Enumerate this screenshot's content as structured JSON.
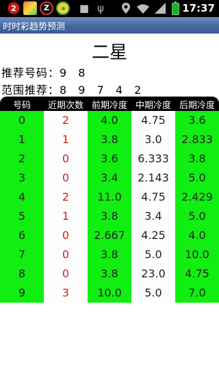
{
  "status_bar": {
    "notification_count": "2",
    "app2_letter": "Z",
    "time": "17:37",
    "icons": [
      "notification-badge-icon",
      "app-icon",
      "z-app-icon",
      "app-icon",
      "android-icon",
      "usb-icon",
      "gps-icon",
      "wifi-icon",
      "signal-icon",
      "battery-icon"
    ]
  },
  "title_bar": {
    "title": "时时彩趋势预测"
  },
  "heading": "二星",
  "recommend": {
    "label": "推荐号码：",
    "value": "9 8"
  },
  "range": {
    "label": "范围推荐：",
    "value": "8 9 7 4 2"
  },
  "table": {
    "headers": [
      "号码",
      "近期次数",
      "前期冷度",
      "中期冷度",
      "后期冷度"
    ],
    "rows": [
      [
        "0",
        "2",
        "4.0",
        "4.75",
        "3.6"
      ],
      [
        "1",
        "1",
        "3.8",
        "3.0",
        "2.833"
      ],
      [
        "2",
        "0",
        "3.6",
        "6.333",
        "3.8"
      ],
      [
        "3",
        "0",
        "3.4",
        "2.143",
        "5.0"
      ],
      [
        "4",
        "2",
        "11.0",
        "4.75",
        "2.429"
      ],
      [
        "5",
        "1",
        "3.8",
        "3.4",
        "5.0"
      ],
      [
        "6",
        "0",
        "2.667",
        "4.25",
        "4.0"
      ],
      [
        "7",
        "0",
        "3.8",
        "5.0",
        "10.0"
      ],
      [
        "8",
        "0",
        "3.8",
        "23.0",
        "4.75"
      ],
      [
        "9",
        "3",
        "10.0",
        "5.0",
        "7.0"
      ]
    ]
  },
  "colors": {
    "green": "#11ee11",
    "red_text": "#cc2222",
    "title_bar": "#45679e"
  }
}
